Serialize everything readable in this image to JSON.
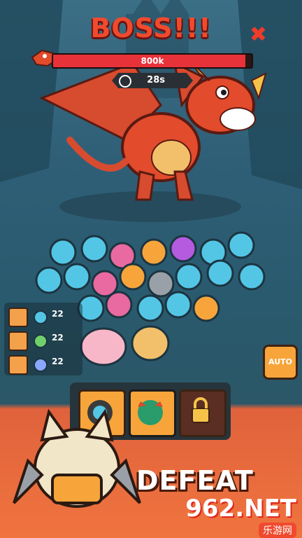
{
  "header": {
    "title": "BOSS!!!",
    "close_label": "✖",
    "hp_value": "800k",
    "hp_fill": 0.97,
    "timer_value": "28s"
  },
  "stats": [
    {
      "icon": "sword-icon",
      "count": "22"
    },
    {
      "icon": "bow-icon",
      "count": "22"
    },
    {
      "icon": "magic-staff-icon",
      "count": "22"
    }
  ],
  "auto_button": {
    "label": "AUTO"
  },
  "slots": [
    {
      "name": "hero-slot-1",
      "locked": false
    },
    {
      "name": "hero-slot-2",
      "locked": false,
      "selected": true
    },
    {
      "name": "hero-slot-3",
      "locked": true
    }
  ],
  "banner": {
    "text": "DEFEAT"
  },
  "watermark": {
    "big": "962.NET",
    "small": "乐游网"
  },
  "colors": {
    "accent": "#f04a2e",
    "hp": "#e8323a",
    "orange": "#f7a53b"
  }
}
